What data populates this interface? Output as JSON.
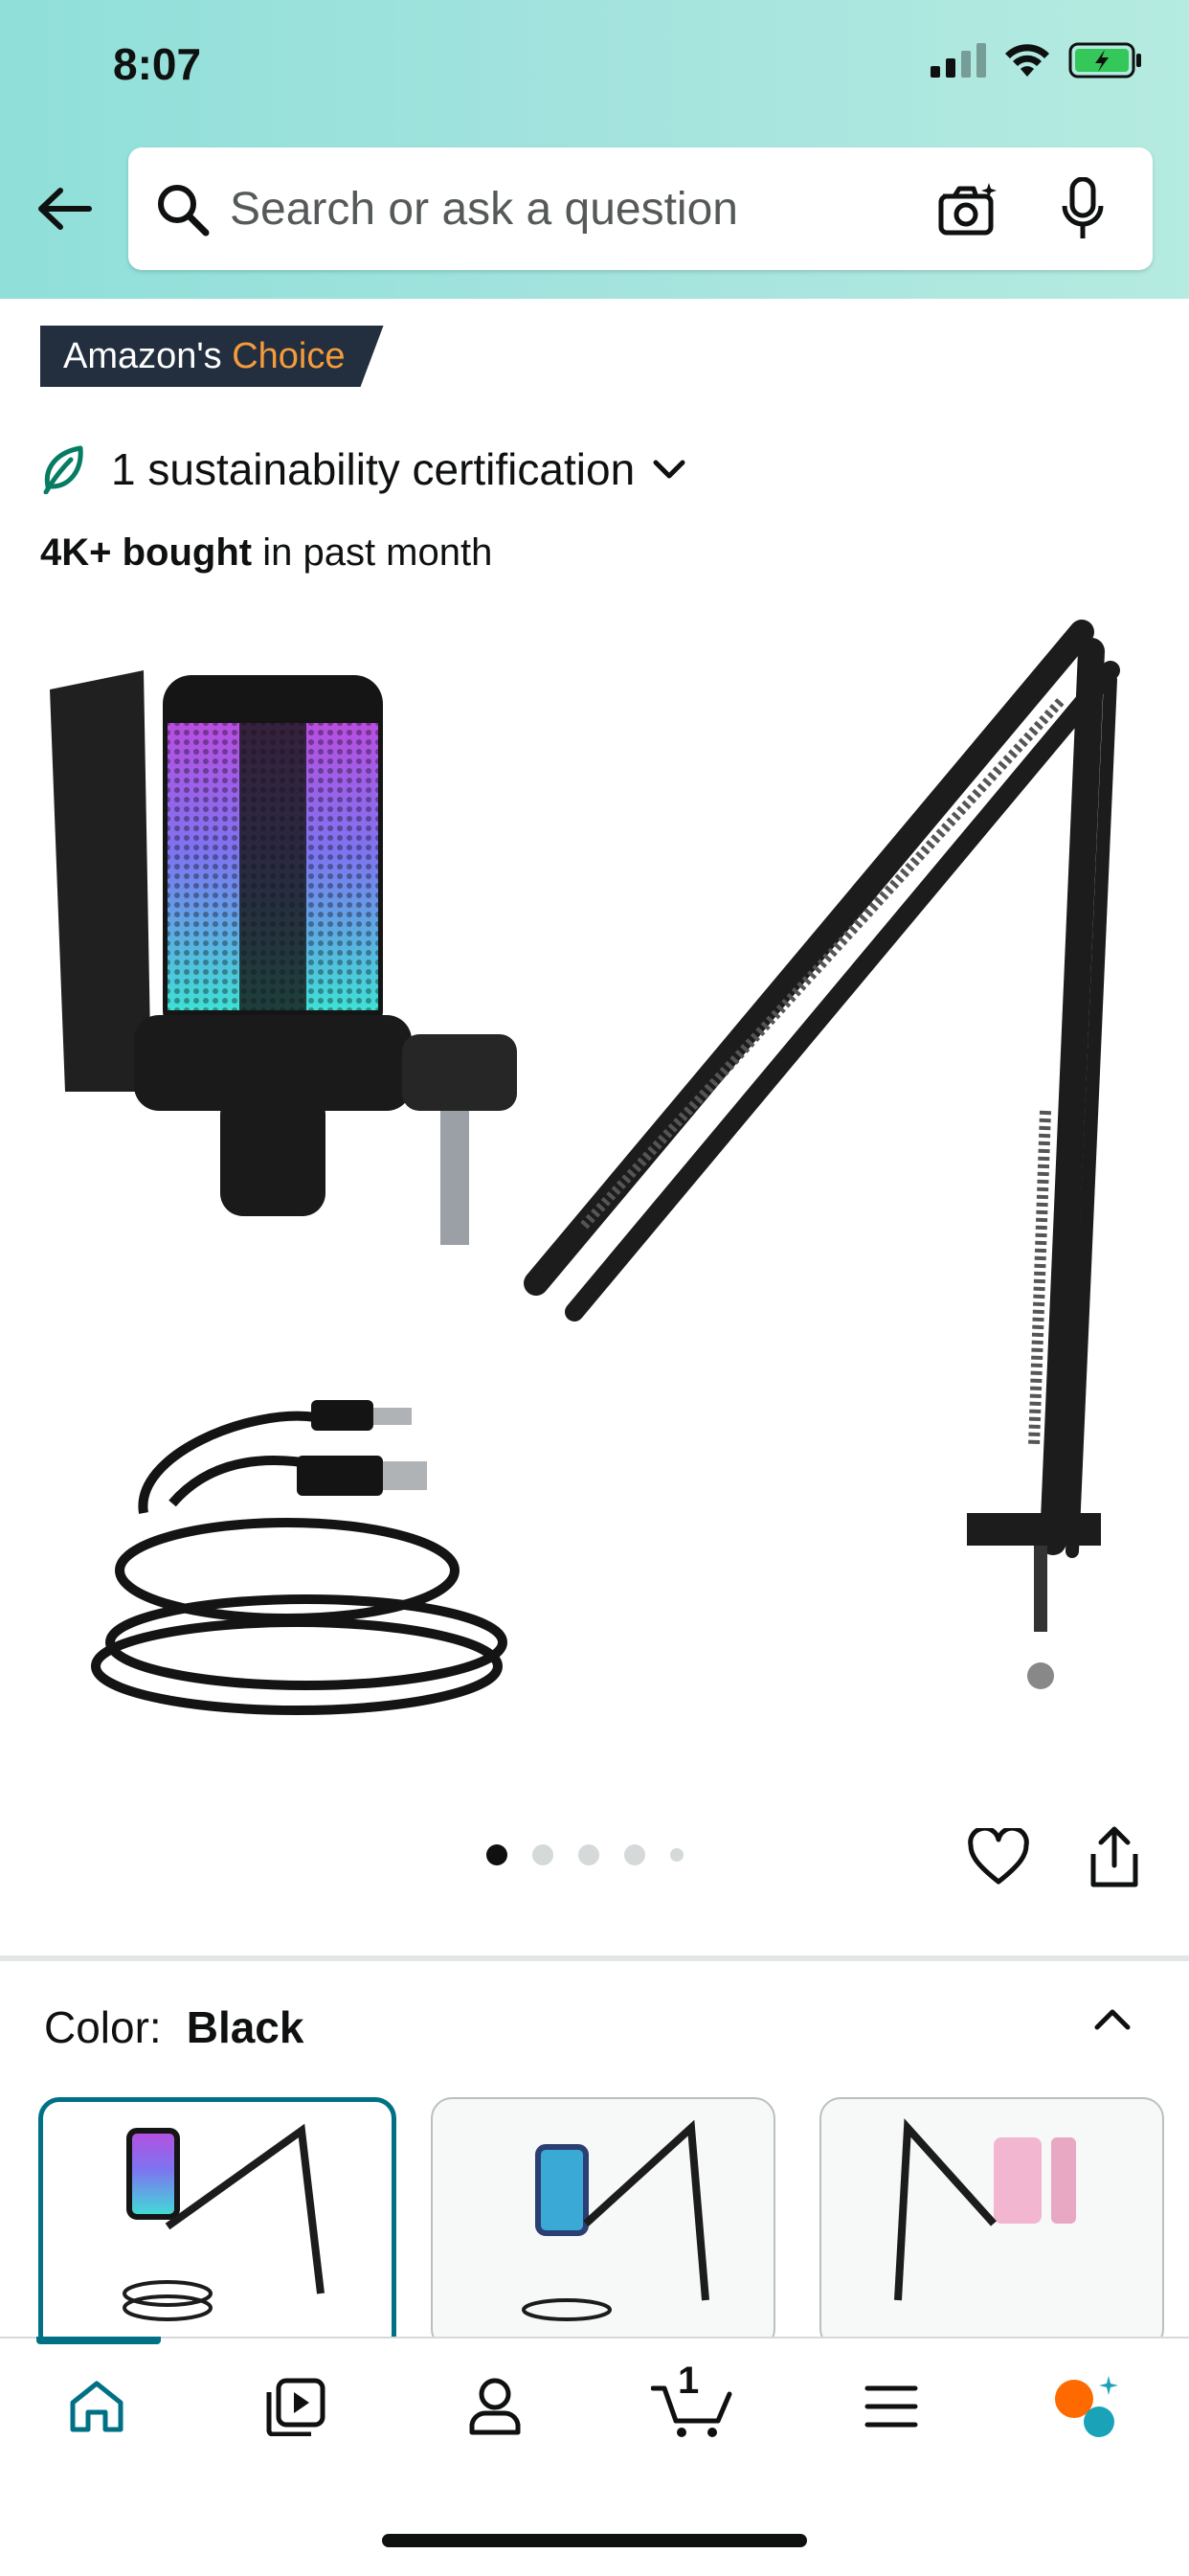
{
  "status_bar": {
    "time": "8:07"
  },
  "search": {
    "placeholder": "Search or ask a question"
  },
  "badge": {
    "prefix": "Amazon's ",
    "highlight": "Choice"
  },
  "sustainability": {
    "label": "1 sustainability certification"
  },
  "bought": {
    "bold": "4K+ bought",
    "rest": " in past month"
  },
  "carousel": {
    "total": 5,
    "active": 1
  },
  "color": {
    "label": "Color:",
    "value": "Black"
  },
  "cart": {
    "count": "1"
  },
  "colors": {
    "accent": "#007185",
    "badge_bg": "#232f3e",
    "badge_hl": "#f69b3c",
    "header": "#a3e3de"
  },
  "icons": [
    "back-arrow-icon",
    "search-icon",
    "camera-icon",
    "mic-icon",
    "leaf-icon",
    "chevron-down-icon",
    "heart-icon",
    "share-icon",
    "chevron-up-icon",
    "home-icon",
    "inspire-icon",
    "account-icon",
    "cart-icon",
    "menu-icon",
    "ai-assistant-icon"
  ]
}
